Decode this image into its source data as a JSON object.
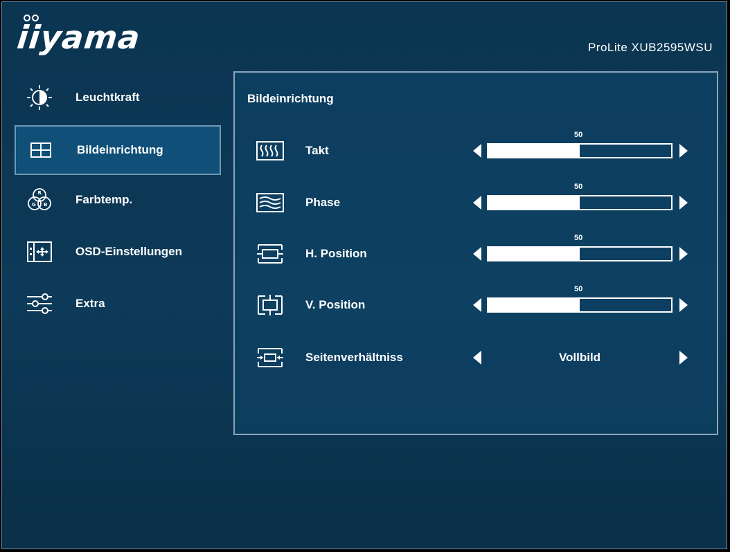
{
  "header": {
    "brand": "iiyama",
    "model": "ProLite XUB2595WSU"
  },
  "sidebar": {
    "items": [
      {
        "label": "Leuchtkraft",
        "icon": "brightness-icon",
        "active": false
      },
      {
        "label": "Bildeinrichtung",
        "icon": "image-setup-icon",
        "active": true
      },
      {
        "label": "Farbtemp.",
        "icon": "color-temp-icon",
        "active": false
      },
      {
        "label": "OSD-Einstellungen",
        "icon": "osd-settings-icon",
        "active": false
      },
      {
        "label": "Extra",
        "icon": "extra-settings-icon",
        "active": false
      }
    ]
  },
  "panel": {
    "title": "Bildeinrichtung",
    "rows": [
      {
        "label": "Takt",
        "icon": "clock-icon",
        "type": "slider",
        "value": 50,
        "value_text": "50"
      },
      {
        "label": "Phase",
        "icon": "phase-icon",
        "type": "slider",
        "value": 50,
        "value_text": "50"
      },
      {
        "label": "H. Position",
        "icon": "h-position-icon",
        "type": "slider",
        "value": 50,
        "value_text": "50"
      },
      {
        "label": "V. Position",
        "icon": "v-position-icon",
        "type": "slider",
        "value": 50,
        "value_text": "50"
      },
      {
        "label": "Seitenverhältniss",
        "icon": "aspect-ratio-icon",
        "type": "option",
        "value_text": "Vollbild"
      }
    ]
  },
  "colors": {
    "background": "#0d3a58",
    "active_item": "#0f4f78",
    "border": "#8aa5bb",
    "text": "#ffffff"
  }
}
